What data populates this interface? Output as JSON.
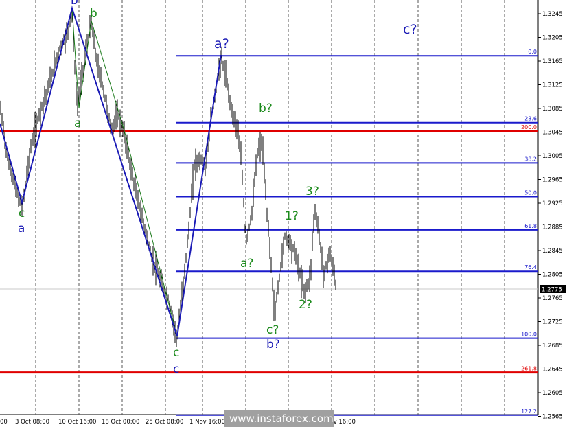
{
  "chart_data": {
    "type": "line",
    "title": "",
    "price_axis": {
      "ticks": [
        "1.3245",
        "1.3205",
        "1.3165",
        "1.3125",
        "1.3085",
        "1.3045",
        "1.3005",
        "1.2965",
        "1.2925",
        "1.2885",
        "1.2845",
        "1.2805",
        "1.2765",
        "1.2725",
        "1.2685",
        "1.2645",
        "1.2605",
        "1.2565"
      ],
      "current_price": "1.2775"
    },
    "time_axis": {
      "ticks": [
        "00",
        "3 Oct 08:00",
        "10 Oct 16:00",
        "18 Oct 00:00",
        "25 Oct 08:00",
        "1 Nov 16:00",
        "8 Nov 16:00"
      ]
    },
    "fib_levels": [
      {
        "label": "0.0",
        "price": 1.3174
      },
      {
        "label": "23.6",
        "price": 1.3061
      },
      {
        "label": "200.0",
        "price": 1.3047
      },
      {
        "label": "38.2",
        "price": 1.2993
      },
      {
        "label": "50.0",
        "price": 1.2936
      },
      {
        "label": "61.8",
        "price": 1.288
      },
      {
        "label": "76.4",
        "price": 1.281
      },
      {
        "label": "100.0",
        "price": 1.2697
      },
      {
        "label": "261.8",
        "price": 1.2639
      },
      {
        "label": "127.2",
        "price": 1.2567
      }
    ],
    "wave_labels": [
      {
        "text": "b",
        "color": "blue"
      },
      {
        "text": "b",
        "color": "green"
      },
      {
        "text": "c",
        "color": "green"
      },
      {
        "text": "a",
        "color": "blue"
      },
      {
        "text": "a",
        "color": "green"
      },
      {
        "text": "a?",
        "color": "blue"
      },
      {
        "text": "b?",
        "color": "green"
      },
      {
        "text": "a?",
        "color": "green"
      },
      {
        "text": "1?",
        "color": "green"
      },
      {
        "text": "3?",
        "color": "green"
      },
      {
        "text": "2?",
        "color": "green"
      },
      {
        "text": "c?",
        "color": "green"
      },
      {
        "text": "b?",
        "color": "blue"
      },
      {
        "text": "c",
        "color": "green"
      },
      {
        "text": "c",
        "color": "blue"
      },
      {
        "text": "c?",
        "color": "blue"
      }
    ],
    "colors": {
      "price_bars": "#000000",
      "wave_line_blue": "#1a1ab5",
      "wave_line_green": "#1b7a1b",
      "fib_line": "#1a1acc",
      "fib_red": "#e00000",
      "grid": "#555555"
    },
    "grid": true
  },
  "watermark": "www.instaforex.com"
}
